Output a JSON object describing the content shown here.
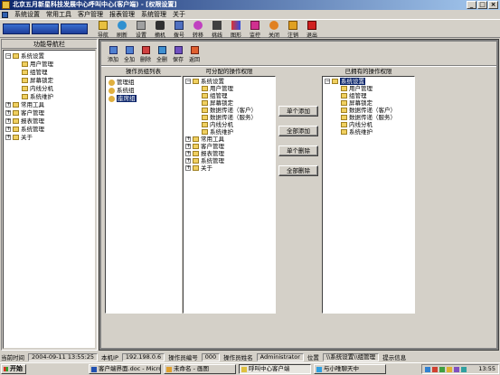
{
  "window": {
    "title": "北京五月新星科技发展中心呼叫中心(客户端) - [权限设置]"
  },
  "menu": [
    "系统设置",
    "常用工具",
    "客户管理",
    "报表管理",
    "系统管理",
    "关于"
  ],
  "blue_buttons": [
    "",
    "",
    ""
  ],
  "toolbar": [
    "导航",
    "刷新",
    "设置",
    "摘机",
    "拨号",
    "转移",
    "挑线",
    "图形",
    "监控",
    "关闭",
    "注销",
    "退出"
  ],
  "nav": {
    "header": "功能导航栏",
    "tree": [
      {
        "label": "系统设置",
        "expanded": true,
        "children": [
          "用户管理",
          "组管理",
          "屏幕锁定",
          "内线分机",
          "系统维护"
        ]
      },
      {
        "label": "常用工具"
      },
      {
        "label": "客户管理"
      },
      {
        "label": "报表管理"
      },
      {
        "label": "系统管理"
      },
      {
        "label": "关于"
      }
    ]
  },
  "subtoolbar": [
    "添加",
    "全加",
    "删除",
    "全删",
    "保存",
    "返回"
  ],
  "groups": {
    "title": "操作员组列表",
    "items": [
      "管理组",
      "系统组",
      "座席组"
    ],
    "selected": 2
  },
  "available": {
    "title": "可分配的操作权限",
    "tree": [
      {
        "label": "系统设置",
        "children": [
          "用户管理",
          "组管理",
          "屏幕锁定",
          "数据传递（客户）",
          "数据传递（服务）",
          "内线分机",
          "系统维护"
        ]
      },
      {
        "label": "常用工具"
      },
      {
        "label": "客户管理"
      },
      {
        "label": "报表管理"
      },
      {
        "label": "系统管理"
      },
      {
        "label": "关于"
      }
    ]
  },
  "actions": [
    "单个添加",
    "全部添加",
    "单个删除",
    "全部删除"
  ],
  "owned": {
    "title": "已拥有的操作权限",
    "root": "系统设置",
    "children": [
      "用户管理",
      "组管理",
      "屏幕锁定",
      "数据传递（客户）",
      "数据传递（服务）",
      "内线分机",
      "系统维护"
    ]
  },
  "status": {
    "time_label": "当前时间",
    "time": "2004-09-11 13:55:25",
    "ip_label": "本机IP",
    "ip": "192.198.0.6",
    "opno_label": "操作员编号",
    "opno": "000",
    "opname_label": "操作员姓名",
    "opname": "Administrator",
    "pos_label": "位置",
    "pos": "\\\\系统设置\\\\组管理",
    "hint_label": "提示信息"
  },
  "taskbar": {
    "start": "开始",
    "tasks": [
      "客户端界面.doc - Micro...",
      "未命名 - 画图",
      "呼叫中心客户端",
      "与小唯聊天中"
    ],
    "clock": "13:55"
  }
}
